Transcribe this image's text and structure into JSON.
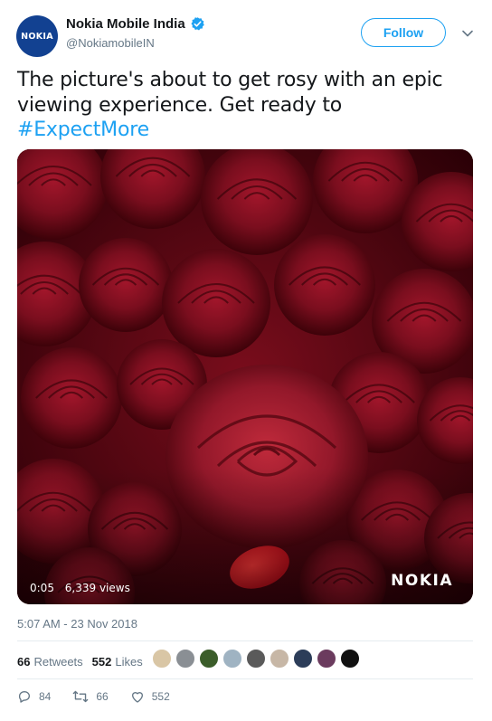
{
  "account": {
    "avatar_text": "NOKIA",
    "display_name": "Nokia Mobile India",
    "handle": "@NokiamobileIN",
    "follow_label": "Follow",
    "brand_color": "#124191"
  },
  "tweet": {
    "text_before": "The picture's about to get rosy with an epic viewing experience. Get ready to",
    "hashtag": "#ExpectMore",
    "timestamp": "5:07 AM - 23 Nov 2018"
  },
  "video": {
    "duration": "0:05",
    "views": "6,339 views",
    "brand": "NOKIA"
  },
  "stats": {
    "retweets_count": "66",
    "retweets_label": "Retweets",
    "likes_count": "552",
    "likes_label": "Likes",
    "liker_avatar_colors": [
      "#d9c6a5",
      "#8a8f94",
      "#3b5d2a",
      "#9fb3c2",
      "#5a5a5a",
      "#c7b7a6",
      "#2c3d59",
      "#6b3b5e",
      "#111111"
    ]
  },
  "actions": {
    "replies": "84",
    "retweets": "66",
    "likes": "552"
  },
  "colors": {
    "link": "#1da1f2",
    "muted": "#657786",
    "text": "#14171a"
  }
}
